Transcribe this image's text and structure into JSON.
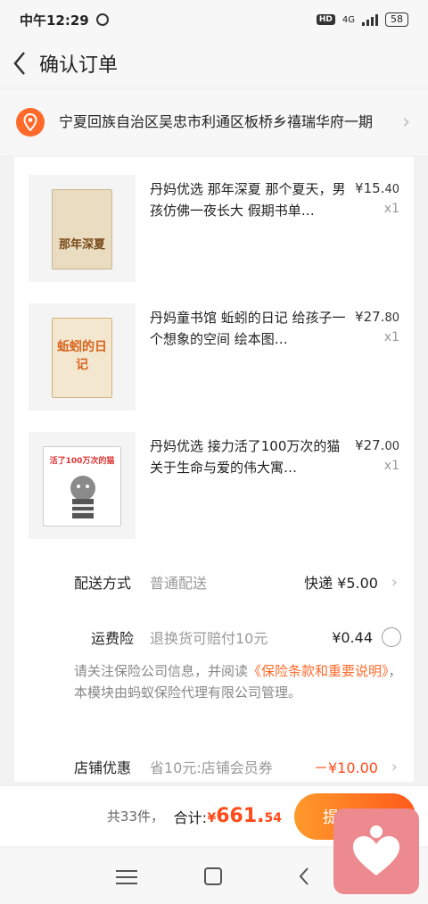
{
  "status_bar": {
    "time": "中午12:29",
    "hd": "HD",
    "network": "4G",
    "battery": "58"
  },
  "nav": {
    "title": "确认订单"
  },
  "address": {
    "text": "宁夏回族自治区吴忠市利通区板桥乡禧瑞华府一期"
  },
  "products": [
    {
      "title": "丹妈优选 那年深夏 那个夏天，男孩仿佛一夜长大 假期书单…",
      "price_main": "¥15.",
      "price_cents": "40",
      "qty": "x1",
      "cover_text": "那年深夏",
      "cover_color": "#e9dcc0"
    },
    {
      "title": "丹妈童书馆 蚯蚓的日记 给孩子一个想象的空间 绘本图…",
      "price_main": "¥27.",
      "price_cents": "80",
      "qty": "x1",
      "cover_text": "蚯蚓的日记",
      "cover_color": "#f4e7cf"
    },
    {
      "title": "丹妈优选 接力活了100万次的猫 关于生命与爱的伟大寓…",
      "price_main": "¥27.",
      "price_cents": "00",
      "qty": "x1",
      "cover_text": "活了100万次的猫",
      "cover_color": "#ffffff"
    }
  ],
  "delivery": {
    "label": "配送方式",
    "sub": "普通配送",
    "value": "快递 ¥5.00"
  },
  "freight_insurance": {
    "label": "运费险",
    "sub": "退换货可赔付10元",
    "value": "¥0.44"
  },
  "notice": {
    "prefix": "请关注保险公司信息，并阅读",
    "link": "《保险条款和重要说明》",
    "suffix": "，本模块由蚂蚁保险代理有限公司管理。"
  },
  "store_discount": {
    "label": "店铺优惠",
    "sub": "省10元:店铺会员券",
    "value": "－¥10.00"
  },
  "footer": {
    "count": "共33件，",
    "total_label": "合计:",
    "total_yen": "¥",
    "total_main": "661.",
    "total_cents": "54",
    "submit": "提交订单"
  },
  "colors": {
    "accent": "#ff6a2b",
    "price_red": "#ff4a1a"
  }
}
